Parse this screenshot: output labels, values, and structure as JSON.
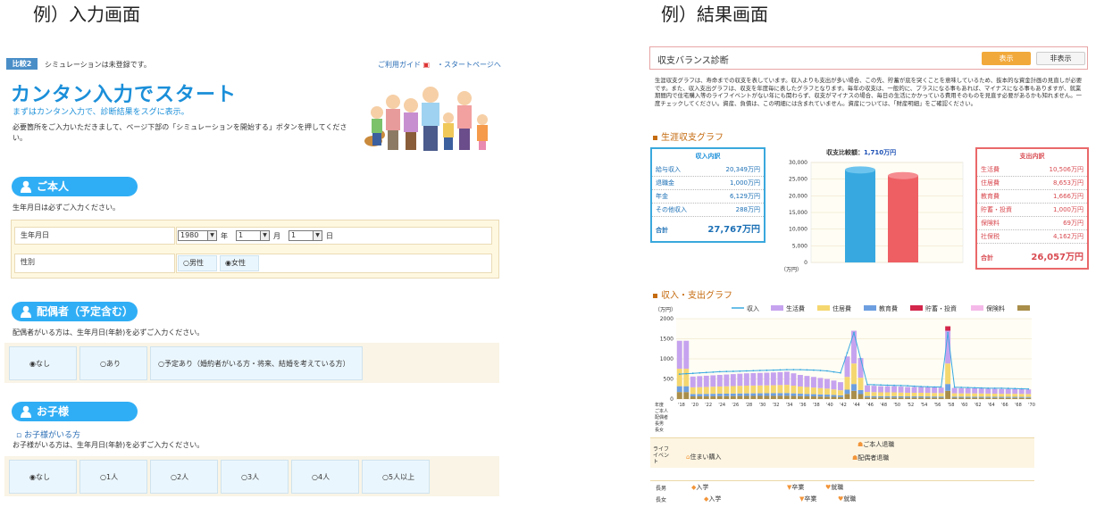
{
  "captions": {
    "left": "例）入力画面",
    "right": "例）結果画面"
  },
  "left": {
    "badge": "比較2",
    "status": "シミュレーションは未登録です。",
    "guide_link": "ご利用ガイド",
    "start_link": "・スタートページへ",
    "title": "カンタン入力でスタート",
    "subtitle": "まずはカンタン入力で、診断結果をスグに表示。",
    "desc": "必要箇所をご入力いただきまして、ページ下部の「シミュレーションを開始する」ボタンを押してください。",
    "self": {
      "heading": "ご本人",
      "note": "生年月日は必ずご入力ください。",
      "birth_label": "生年月日",
      "year_value": "1980",
      "year_unit": "年",
      "month_value": "1",
      "month_unit": "月",
      "day_value": "1",
      "day_unit": "日",
      "gender_label": "性別",
      "gender_options": [
        "○男性",
        "◉女性"
      ]
    },
    "spouse": {
      "heading": "配偶者（予定含む）",
      "note": "配偶者がいる方は、生年月日(年齢)を必ずご入力ください。",
      "options": [
        "◉なし",
        "○あり",
        "○予定あり（婚約者がいる方・将来、結婚を考えている方）"
      ]
    },
    "children": {
      "heading": "お子様",
      "sublink": "お子様がいる方",
      "note": "お子様がいる方は、生年月日(年齢)を必ずご入力ください。",
      "options": [
        "◉なし",
        "○1人",
        "○2人",
        "○3人",
        "○4人",
        "○5人以上"
      ]
    }
  },
  "right": {
    "panel_title": "収支バランス診断",
    "show_button": "表示",
    "hide_button": "非表示",
    "description": "生涯収支グラフは、寿命までの収支を表しています。収入よりも支出が多い場合、この先、貯蓄が底を突くことを意味しているため、抜本的な資金計画の見直しが必要です。また、収入支出グラフは、収支を年度毎に表したグラフとなります。毎年の収支は、一般的に、プラスになる事もあれば、マイナスになる事もありますが、就業期間内で住宅購入等のライフイベントがない年にも関わらず、収支がマイナスの場合、毎日の生活にかかっている費用そのものを見直す必要があるかも知れません。一度チェックしてください。資産、負債は、この明細には含まれていません。資産については、「財産明細」をご確認ください。",
    "lifetime_title": "生涯収支グラフ",
    "income": {
      "title": "収入内訳",
      "rows": [
        [
          "給与収入",
          "20,349万円"
        ],
        [
          "退職金",
          "1,000万円"
        ],
        [
          "年金",
          "6,129万円"
        ],
        [
          "その他収入",
          "288万円"
        ]
      ],
      "total_label": "合計",
      "total_value": "27,767万円"
    },
    "expense": {
      "title": "支出内訳",
      "rows": [
        [
          "生活費",
          "10,506万円"
        ],
        [
          "住居費",
          "8,653万円"
        ],
        [
          "教育費",
          "1,666万円"
        ],
        [
          "貯蓄・投資",
          "1,000万円"
        ],
        [
          "保険料",
          "69万円"
        ],
        [
          "社保税",
          "4,162万円"
        ]
      ],
      "total_label": "合計",
      "total_value": "26,057万円"
    },
    "balance_label": "収支比較額：",
    "balance_value": "1,710万円",
    "balance_ticks": [
      "30,000",
      "25,000",
      "20,000",
      "15,000",
      "10,000",
      "5,000",
      "0"
    ],
    "balance_unit": "（万円）",
    "yearly_title": "収入・支出グラフ",
    "legend": [
      "収入",
      "生活費",
      "住居費",
      "教育費",
      "貯蓄・投資",
      "保険料",
      "社保税"
    ],
    "colors": {
      "income": "#38a9e0",
      "expense": "#ee5f64",
      "living": "#c6a3ef",
      "housing": "#f5d770",
      "education": "#6d9fe0",
      "savings": "#d3264a",
      "insurance": "#f4b9e8",
      "social": "#a98e4a"
    },
    "yearly_unit": "（万円）",
    "yearly_ticks": [
      "2000",
      "1500",
      "1000",
      "500",
      "0"
    ],
    "row_labels": [
      "年度",
      "ご本人",
      "配偶者",
      "長男",
      "長女"
    ],
    "life_event_label": "ライフイベント",
    "events": {
      "house": "住まい購入",
      "retire_self": "ご本人退職",
      "retire_spouse": "配偶者退職",
      "son": "長男",
      "daughter": "長女",
      "enter": "入学",
      "graduate": "卒業",
      "employ": "就職"
    }
  },
  "chart_data": [
    {
      "type": "bar",
      "title": "収支比較額：1,710万円",
      "categories": [
        "収入",
        "支出"
      ],
      "values": [
        27767,
        26057
      ],
      "ylim": [
        0,
        30000
      ],
      "ylabel": "（万円）"
    },
    {
      "type": "bar",
      "title": "収入・支出グラフ",
      "ylabel": "（万円）",
      "ylim": [
        0,
        2000
      ],
      "x": [
        "'18",
        "'20",
        "'22",
        "'24",
        "'26",
        "'28",
        "'30",
        "'32",
        "'34",
        "'36",
        "'38",
        "'40",
        "'42",
        "'44",
        "'46",
        "'48",
        "'50",
        "'52",
        "'54",
        "'56",
        "'58",
        "'60",
        "'62",
        "'64",
        "'66",
        "'68",
        "'70"
      ],
      "series": [
        {
          "name": "収入",
          "values": [
            620,
            640,
            660,
            680,
            690,
            700,
            710,
            720,
            730,
            730,
            720,
            700,
            650,
            1650,
            360,
            350,
            340,
            330,
            310,
            300,
            300,
            290,
            280,
            270,
            270,
            260,
            250
          ]
        },
        {
          "name": "支出合計",
          "values": [
            1450,
            560,
            580,
            600,
            620,
            640,
            650,
            660,
            680,
            600,
            550,
            500,
            420,
            1700,
            340,
            320,
            320,
            300,
            300,
            290,
            280,
            270,
            270,
            260,
            250,
            250,
            240
          ]
        }
      ]
    }
  ]
}
